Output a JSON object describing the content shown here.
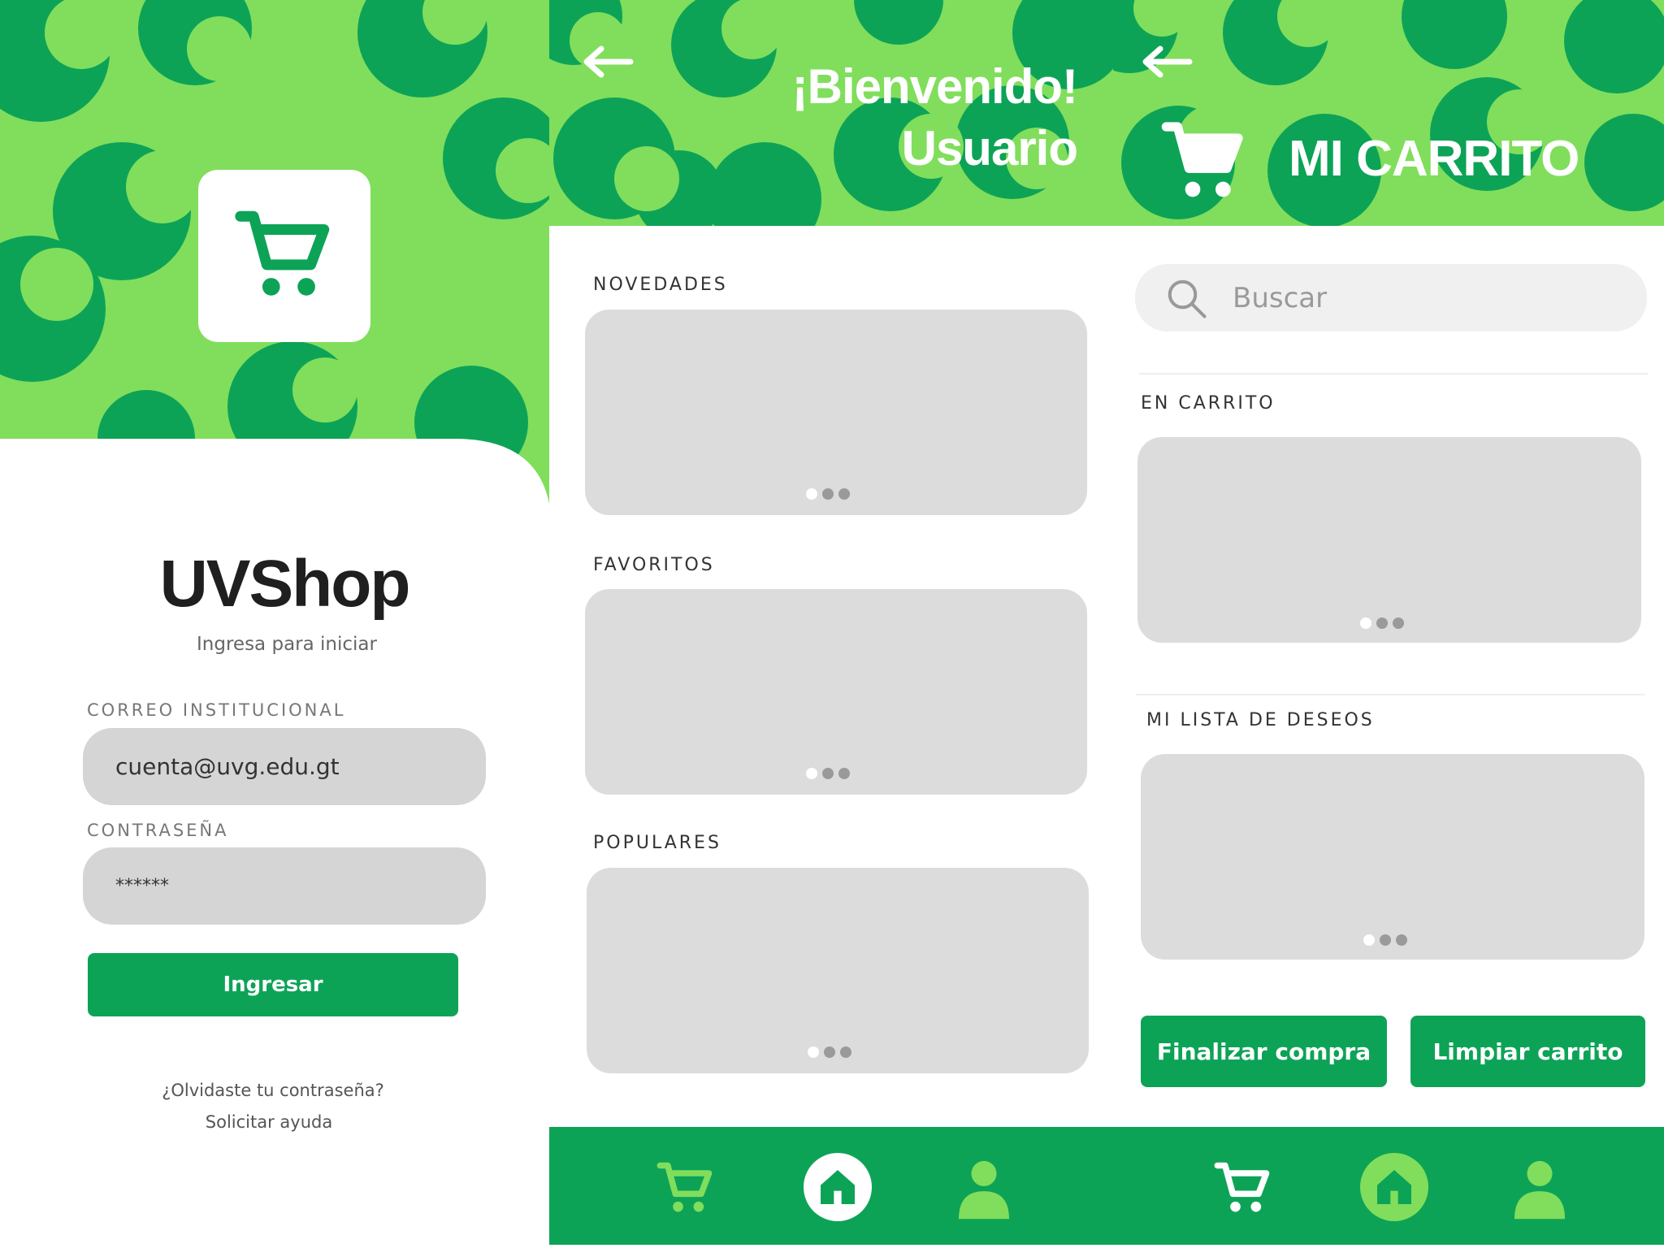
{
  "colors": {
    "green_light": "#80de5c",
    "green_dark": "#0da357",
    "card": "#dcdcdc",
    "white": "#ffffff"
  },
  "login": {
    "app_name": "UVShop",
    "subtitle": "Ingresa para iniciar",
    "email_label": "CORREO INSTITUCIONAL",
    "email_value": "cuenta@uvg.edu.gt",
    "password_label": "CONTRASEÑA",
    "password_value": "******",
    "submit_label": "Ingresar",
    "forgot_link": "¿Olvidaste tu contraseña?",
    "help_link": "Solicitar ayuda",
    "logo_icon": "cart-icon"
  },
  "home": {
    "greeting_line1": "¡Bienvenido!",
    "greeting_line2": "Usuario",
    "sections": [
      {
        "title": "NOVEDADES"
      },
      {
        "title": "FAVORITOS"
      },
      {
        "title": "POPULARES"
      }
    ],
    "nav": [
      "cart-icon",
      "home-icon",
      "user-icon"
    ],
    "active_nav": "home-icon"
  },
  "cart": {
    "title": "MI CARRITO",
    "search_placeholder": "Buscar",
    "sections": [
      {
        "title": "EN CARRITO"
      },
      {
        "title": "MI LISTA DE DESEOS"
      }
    ],
    "checkout_label": "Finalizar compra",
    "clear_label": "Limpiar carrito",
    "nav": [
      "cart-icon",
      "home-icon",
      "user-icon"
    ],
    "active_nav": "home-icon"
  }
}
